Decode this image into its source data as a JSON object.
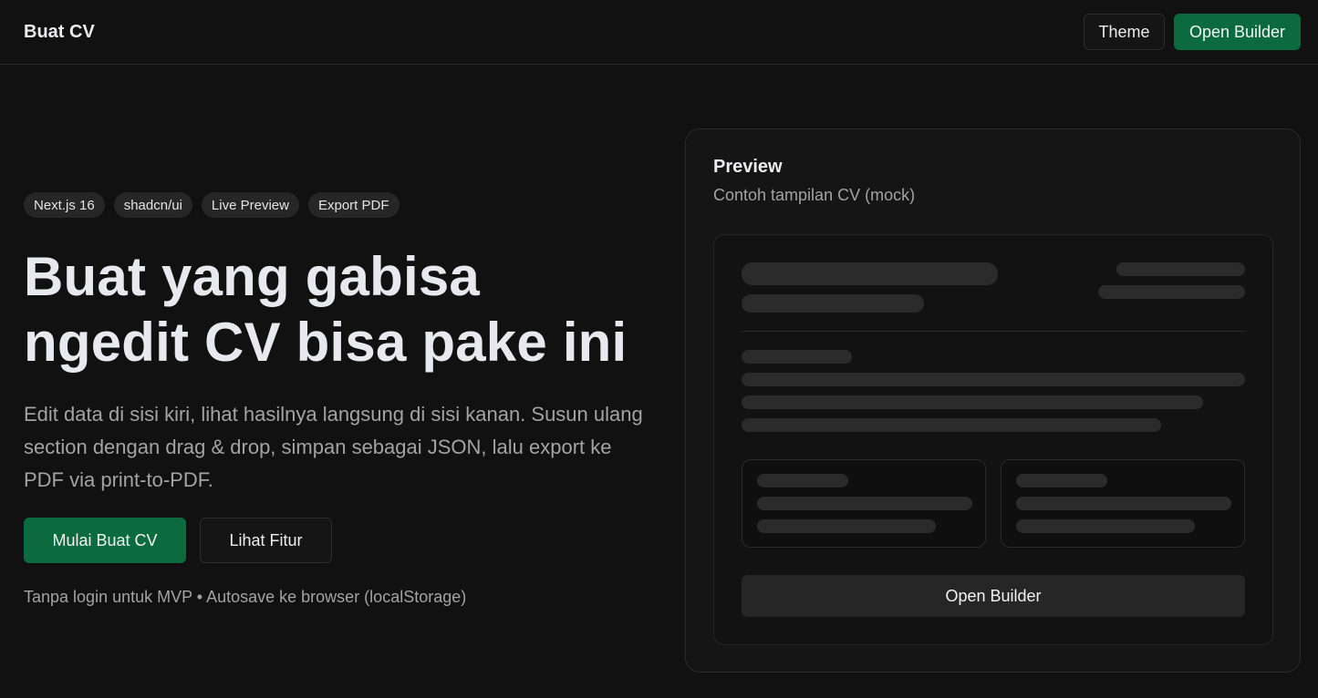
{
  "nav": {
    "brand": "Buat CV",
    "theme_label": "Theme",
    "open_builder_label": "Open Builder"
  },
  "hero": {
    "badges": [
      "Next.js 16",
      "shadcn/ui",
      "Live Preview",
      "Export PDF"
    ],
    "headline_line1": "Buat yang gabisa",
    "headline_line2": "ngedit CV bisa pake ini",
    "description": "Edit data di sisi kiri, lihat hasilnya langsung di sisi kanan. Susun ulang section dengan drag & drop, simpan sebagai JSON, lalu export ke PDF via print-to-PDF.",
    "cta_primary": "Mulai Buat CV",
    "cta_secondary": "Lihat Fitur",
    "note": "Tanpa login untuk MVP • Autosave ke browser (localStorage)"
  },
  "preview": {
    "title": "Preview",
    "subtitle": "Contoh tampilan CV (mock)",
    "mock_button": "Open Builder"
  },
  "colors": {
    "background": "#111111",
    "primary": "#0b6b3e",
    "skeleton": "#2b2b2b"
  }
}
